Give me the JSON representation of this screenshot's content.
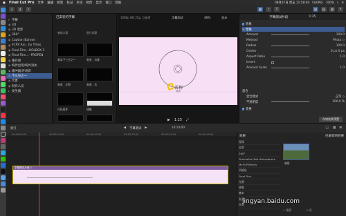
{
  "menu": {
    "app": "Final Cut Pro",
    "items": [
      "文件",
      "编辑",
      "修剪",
      "标记",
      "片段",
      "修改",
      "显示",
      "窗口",
      "帮助"
    ],
    "status": [
      "08月07日 周五 11:58:40",
      "FLKING",
      "100%"
    ]
  },
  "toolbar": {
    "title_btn": "已安装的字幕",
    "share_label": "↑"
  },
  "sidebar": {
    "items": [
      {
        "label": "字幕",
        "tri": "▾"
      },
      {
        "label": "3D",
        "tri": ""
      },
      {
        "label": "3D 电影",
        "tri": ""
      },
      {
        "label": "360°",
        "tri": ""
      },
      {
        "label": "Caption Banner",
        "tri": ""
      },
      {
        "label": "FCPX Ani...hy Titles",
        "tri": ""
      },
      {
        "label": "Final Film...OOLBOX 3",
        "tri": ""
      },
      {
        "label": "Final Film...- PROPEN",
        "tri": ""
      },
      {
        "label": "缓存组",
        "tri": ""
      },
      {
        "label": "构件出现/构件消失",
        "tri": ""
      },
      {
        "label": "缓冲器/开场白",
        "tri": ""
      },
      {
        "label": "下三分之一",
        "tri": ""
      },
      {
        "label": "元素",
        "tri": ""
      },
      {
        "label": "制作人员",
        "tri": ""
      },
      {
        "label": "发生器",
        "tri": "▸"
      }
    ]
  },
  "browser": {
    "header": "已安装的字幕",
    "col1": "基础字幕",
    "col2": "图片标题",
    "thumbs": [
      {
        "label": "基本下三分之一"
      },
      {
        "label": "渐变 - 边缘"
      },
      {
        "label": "渐变 - 左侧"
      },
      {
        "label": "渐变 - 右"
      },
      {
        "label": "闪烁组件"
      },
      {
        "label": "镜像"
      }
    ]
  },
  "viewer": {
    "info": "1080p HD 25p, 立体声",
    "clip": "字幕测试",
    "zoom": "46%",
    "display": "显示",
    "title_text": "名称",
    "subtitle_text": "描述",
    "timecode": "1:25"
  },
  "inspector": {
    "title": "字幕测试片段",
    "duration": "1:25",
    "sections": [
      {
        "label": "效果",
        "value": ""
      },
      {
        "label": "暗角",
        "value": ""
      },
      {
        "label": "Amount",
        "value": "100.0"
      },
      {
        "label": "Method",
        "value": "Photo ◇"
      },
      {
        "label": "Radius",
        "value": "100.0"
      },
      {
        "label": "Center",
        "value": "0 px   0 px"
      },
      {
        "label": "Aspect Ratio",
        "value": "1.0"
      },
      {
        "label": "Invert",
        "value": ""
      },
      {
        "label": "Amount Scale",
        "value": "1.0"
      }
    ],
    "composite": {
      "header": "混合",
      "mode_label": "混合模式",
      "mode_value": "正常 ◇",
      "opacity_label": "不透明度",
      "opacity_value": "100.0 %"
    },
    "transform_label": "变换",
    "save_btn": "存储效果预置"
  },
  "timeline": {
    "index": "索引",
    "project": "字幕测试",
    "timecode": "14:14:00",
    "ticks": [
      "00:00:00:00",
      "00:00:05:00",
      "00:00:10:00",
      "00:00:15:00",
      "00:00:20:00",
      "00:00:25:00"
    ],
    "clip_label": "字幕测试片段 1"
  },
  "effects": {
    "header": "效果",
    "category": "已安装的效果",
    "list": [
      "视频",
      "全部",
      "360°",
      "Dramaflex Nat Atmosphere",
      "MyFCPEffects",
      "风格化",
      "Final Film",
      "光源",
      "修复",
      "基本",
      "失真",
      "外观"
    ],
    "thumb_label": "暗角",
    "count": "0 项",
    "search_placeholder": "搜索"
  },
  "watermark": "jingyan.baidu.com",
  "colors": {
    "accent": "#3d5c91",
    "clip": "#f6e2f6",
    "viewer_bg": "#f7dff5",
    "playhead": "#e24c2c"
  }
}
